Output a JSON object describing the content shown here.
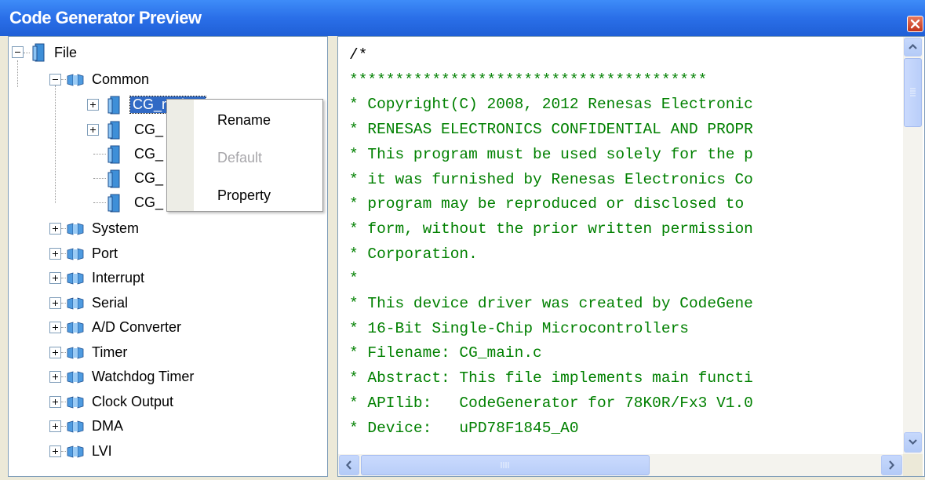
{
  "window": {
    "title": "Code Generator Preview",
    "close_icon": "close-icon"
  },
  "tree": {
    "root": {
      "label": "File",
      "icon": "file-icon"
    },
    "common": {
      "label": "Common",
      "icon": "folder-icon"
    },
    "common_children": [
      {
        "label": "CG_main.c",
        "icon": "file-icon",
        "expander": "plus",
        "selected": true
      },
      {
        "label": "CG_",
        "icon": "file-icon",
        "expander": "plus"
      },
      {
        "label": "CG_",
        "icon": "file-icon"
      },
      {
        "label": "CG_",
        "icon": "file-icon"
      },
      {
        "label": "CG_",
        "icon": "file-icon"
      }
    ],
    "groups": [
      {
        "label": "System"
      },
      {
        "label": "Port"
      },
      {
        "label": "Interrupt"
      },
      {
        "label": "Serial"
      },
      {
        "label": "A/D Converter"
      },
      {
        "label": "Timer"
      },
      {
        "label": "Watchdog Timer"
      },
      {
        "label": "Clock Output"
      },
      {
        "label": "DMA"
      },
      {
        "label": "LVI"
      }
    ]
  },
  "context_menu": {
    "items": [
      {
        "label": "Rename",
        "enabled": true
      },
      {
        "label": "Default",
        "enabled": false
      },
      {
        "label": "Property",
        "enabled": true
      }
    ]
  },
  "code": {
    "lines": [
      "/*",
      "***************************************",
      "* Copyright(C) 2008, 2012 Renesas Electronic",
      "* RENESAS ELECTRONICS CONFIDENTIAL AND PROPR",
      "* This program must be used solely for the p",
      "* it was furnished by Renesas Electronics Co",
      "* program may be reproduced or disclosed to",
      "* form, without the prior written permission",
      "* Corporation.",
      "*",
      "* This device driver was created by CodeGene",
      "* 16-Bit Single-Chip Microcontrollers",
      "* Filename: CG_main.c",
      "* Abstract: This file implements main functi",
      "* APIlib:   CodeGenerator for 78K0R/Fx3 V1.0",
      "* Device:   uPD78F1845_A0"
    ],
    "comment_color": "#008000"
  },
  "colors": {
    "title_bar": "#2A6FE8",
    "selection": "#316AC5"
  }
}
